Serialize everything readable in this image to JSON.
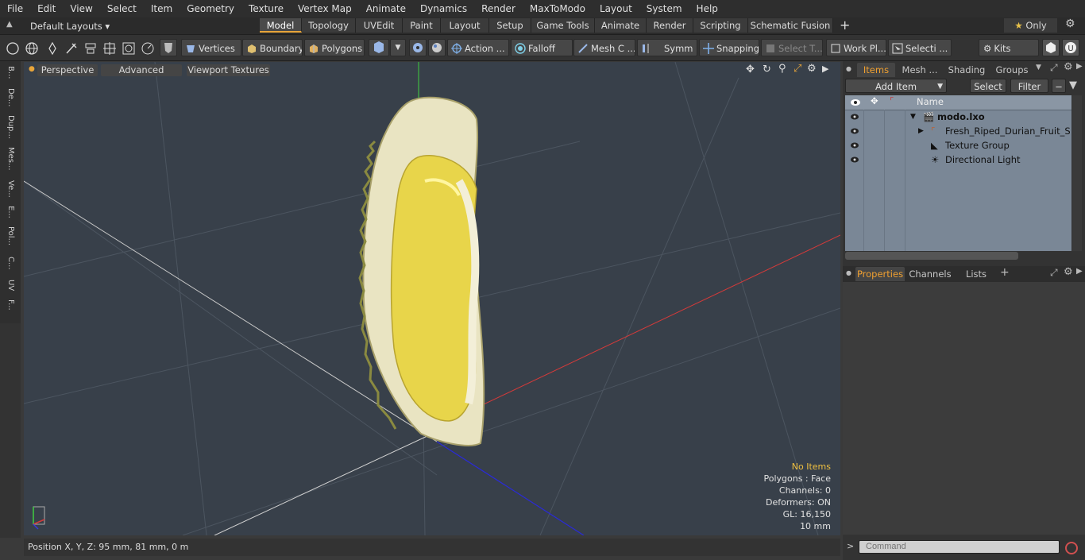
{
  "menubar": {
    "items": [
      "File",
      "Edit",
      "View",
      "Select",
      "Item",
      "Geometry",
      "Texture",
      "Vertex Map",
      "Animate",
      "Dynamics",
      "Render",
      "MaxToModo",
      "Layout",
      "System",
      "Help"
    ]
  },
  "layoutbar": {
    "layout_selector": "Default Layouts",
    "tabs": [
      "Model",
      "Topology",
      "UVEdit",
      "Paint",
      "Layout",
      "Setup",
      "Game Tools",
      "Animate",
      "Render",
      "Scripting",
      "Schematic Fusion"
    ],
    "active_tab": "Model",
    "only_label": "Only"
  },
  "toolbar": {
    "vertices": "Vertices",
    "boundary": "Boundary",
    "polygons": "Polygons",
    "action": "Action ...",
    "falloff": "Falloff",
    "mesh_constraints": "Mesh C ...",
    "symmetry": "Symm ...",
    "snapping": "Snapping",
    "select_through": "Select T...",
    "work_plane": "Work Pl...",
    "selection_sets": "Selecti ...",
    "kits": "Kits"
  },
  "lefttabs": [
    "B...",
    "De...",
    "Dup...",
    "Mes...",
    "Ve...",
    "E...",
    "Pol...",
    "C...",
    "UV",
    "F..."
  ],
  "viewport": {
    "view_mode": "Perspective",
    "shading": "Advanced",
    "textures": "Viewport Textures",
    "info": {
      "selection": "No Items",
      "polygons": "Polygons : Face",
      "channels": "Channels: 0",
      "deformers": "Deformers: ON",
      "gl": "GL: 16,150",
      "grid": "10 mm"
    }
  },
  "statusbar": {
    "position": "Position X, Y, Z:  95 mm, 81 mm, 0 m"
  },
  "rightpanel": {
    "top_tabs": [
      "Items",
      "Mesh ...",
      "Shading",
      "Groups"
    ],
    "active_top_tab": "Items",
    "add_item": "Add Item",
    "select": "Select",
    "filter": "Filter",
    "name_header": "Name",
    "items": [
      {
        "label": "modo.lxo",
        "bold": true
      },
      {
        "label": "Fresh_Riped_Durian_Fruit_Sli..."
      },
      {
        "label": "Texture Group"
      },
      {
        "label": "Directional Light"
      }
    ],
    "bottom_tabs": [
      "Properties",
      "Channels",
      "Lists"
    ],
    "active_bottom_tab": "Properties",
    "command_placeholder": "Command"
  },
  "colors": {
    "accent": "#e8a53a",
    "viewport_bg": "#38404a",
    "list_bg": "#7a8796"
  }
}
